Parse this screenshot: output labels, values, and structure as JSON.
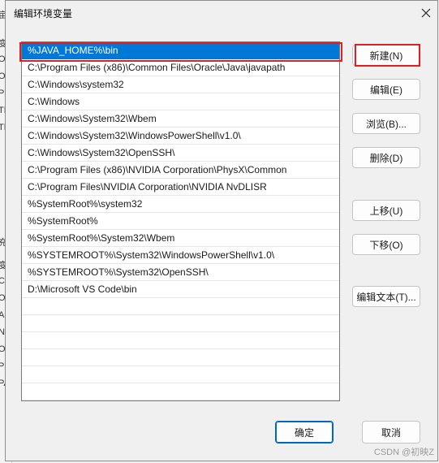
{
  "background_window": {
    "chars": [
      "亩",
      "变",
      "Or",
      "Or",
      "Pa",
      "TE",
      "TN",
      "充",
      "变",
      "Co",
      "Or",
      "A",
      "NI",
      "OS",
      "Pa",
      "PA"
    ]
  },
  "dialog": {
    "title": "编辑环境变量",
    "close_symbol": "✕"
  },
  "paths": [
    "%JAVA_HOME%\\bin",
    "C:\\Program Files (x86)\\Common Files\\Oracle\\Java\\javapath",
    "C:\\Windows\\system32",
    "C:\\Windows",
    "C:\\Windows\\System32\\Wbem",
    "C:\\Windows\\System32\\WindowsPowerShell\\v1.0\\",
    "C:\\Windows\\System32\\OpenSSH\\",
    "C:\\Program Files (x86)\\NVIDIA Corporation\\PhysX\\Common",
    "C:\\Program Files\\NVIDIA Corporation\\NVIDIA NvDLISR",
    "%SystemRoot%\\system32",
    "%SystemRoot%",
    "%SystemRoot%\\System32\\Wbem",
    "%SYSTEMROOT%\\System32\\WindowsPowerShell\\v1.0\\",
    "%SYSTEMROOT%\\System32\\OpenSSH\\",
    "D:\\Microsoft VS Code\\bin",
    "",
    "",
    "",
    "",
    "",
    ""
  ],
  "buttons": {
    "new": "新建(N)",
    "edit": "编辑(E)",
    "browse": "浏览(B)...",
    "delete": "删除(D)",
    "move_up": "上移(U)",
    "move_down": "下移(O)",
    "edit_text": "编辑文本(T)...",
    "ok": "确定",
    "cancel": "取消"
  },
  "watermark": "CSDN @初映Z",
  "colors": {
    "selection": "#0078d7",
    "highlight_box": "#e02020"
  }
}
